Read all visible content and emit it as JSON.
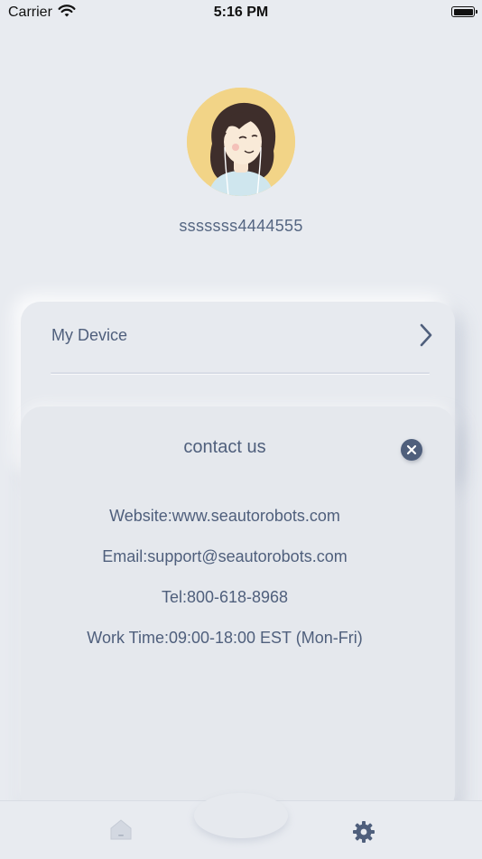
{
  "status_bar": {
    "carrier": "Carrier",
    "time": "5:16 PM",
    "icons": [
      "wifi-icon",
      "battery-icon"
    ]
  },
  "profile": {
    "username": "sssssss4444555",
    "avatar_icon": "user-avatar-illustration"
  },
  "menu": {
    "items": [
      {
        "label": "My Device",
        "icon": "chevron-right-icon"
      }
    ]
  },
  "contact_modal": {
    "title": "contact us",
    "close_icon": "close-icon",
    "lines": [
      "Website:www.seautorobots.com",
      "Email:support@seautorobots.com",
      "Tel:800-618-8968",
      "Work Time:09:00-18:00 EST (Mon-Fri)"
    ]
  },
  "tab_bar": {
    "tabs": [
      {
        "icon": "home-icon"
      },
      {
        "icon": "gear-icon"
      }
    ]
  },
  "colors": {
    "background": "#e8ebf0",
    "text": "#4f5f7c",
    "accent": "#4f5f7c"
  }
}
